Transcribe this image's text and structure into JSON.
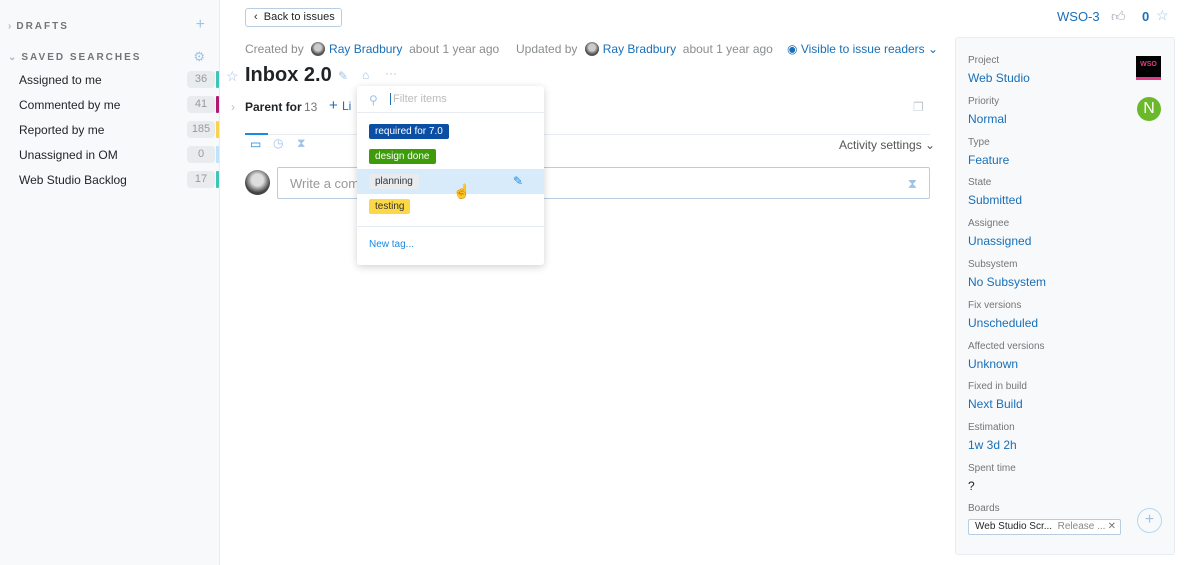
{
  "sidebar": {
    "drafts": "DRAFTS",
    "saved_searches": "SAVED SEARCHES",
    "items": [
      {
        "label": "Assigned to me",
        "count": "36",
        "color": "#3cc6b6"
      },
      {
        "label": "Commented by me",
        "count": "41",
        "color": "#b3186e"
      },
      {
        "label": "Reported by me",
        "count": "185",
        "color": "#f8d24c"
      },
      {
        "label": "Unassigned in OM",
        "count": "0",
        "color": "#bfe3fb"
      },
      {
        "label": "Web Studio Backlog",
        "count": "17",
        "color": "#3cc6b6"
      }
    ]
  },
  "header": {
    "back": "Back to issues",
    "issue_id": "WSO-3",
    "votes": "0"
  },
  "meta": {
    "created_by": "Created by",
    "creator": "Ray Bradbury",
    "created_ago": "about 1 year ago",
    "updated_by": "Updated by",
    "updater": "Ray Bradbury",
    "updated_ago": "about 1 year ago",
    "visibility": "Visible to issue readers"
  },
  "issue": {
    "title": "Inbox 2.0",
    "parent_for": "Parent for",
    "parent_count": "13",
    "link": "Li",
    "comment_placeholder": "Write a com",
    "activity_settings": "Activity settings"
  },
  "tag_dropdown": {
    "placeholder": "Filter items",
    "tags": [
      {
        "label": "required for 7.0",
        "bg": "#0b4fa5",
        "fg": "#ffffff"
      },
      {
        "label": "design done",
        "bg": "#3e9c0b",
        "fg": "#ffffff"
      },
      {
        "label": "planning",
        "bg": "#e8ecef",
        "fg": "#333333"
      },
      {
        "label": "testing",
        "bg": "#fcd844",
        "fg": "#333333"
      }
    ],
    "new_tag": "New tag..."
  },
  "fields": [
    {
      "label": "Project",
      "value": "Web Studio"
    },
    {
      "label": "Priority",
      "value": "Normal"
    },
    {
      "label": "Type",
      "value": "Feature"
    },
    {
      "label": "State",
      "value": "Submitted"
    },
    {
      "label": "Assignee",
      "value": "Unassigned"
    },
    {
      "label": "Subsystem",
      "value": "No Subsystem"
    },
    {
      "label": "Fix versions",
      "value": "Unscheduled"
    },
    {
      "label": "Affected versions",
      "value": "Unknown"
    },
    {
      "label": "Fixed in build",
      "value": "Next Build"
    },
    {
      "label": "Estimation",
      "value": "1w 3d 2h"
    },
    {
      "label": "Spent time",
      "value": "?"
    }
  ],
  "boards": {
    "label": "Boards",
    "board": "Web Studio Scr...",
    "sprint": "Release ..."
  },
  "project_logo": "WSO",
  "priority_letter": "N"
}
